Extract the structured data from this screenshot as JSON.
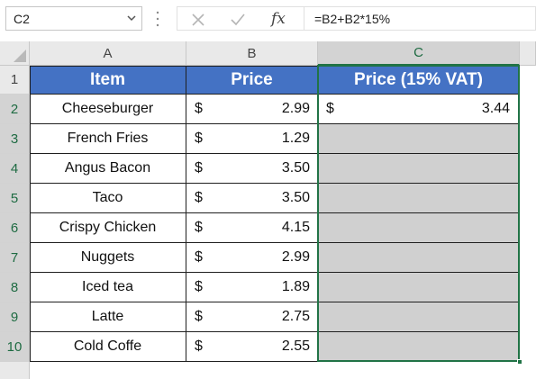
{
  "formula_bar": {
    "name_box": "C2",
    "formula": "=B2+B2*15%",
    "fx_label": "fx"
  },
  "columns": [
    "A",
    "B",
    "C"
  ],
  "rows": [
    "1",
    "2",
    "3",
    "4",
    "5",
    "6",
    "7",
    "8",
    "9",
    "10"
  ],
  "table": {
    "headers": {
      "item": "Item",
      "price": "Price",
      "vat": "Price (15% VAT)"
    },
    "currency": "$",
    "items": [
      {
        "item": "Cheeseburger",
        "price": "2.99",
        "vat": "3.44"
      },
      {
        "item": "French Fries",
        "price": "1.29",
        "vat": ""
      },
      {
        "item": "Angus Bacon",
        "price": "3.50",
        "vat": ""
      },
      {
        "item": "Taco",
        "price": "3.50",
        "vat": ""
      },
      {
        "item": "Crispy Chicken",
        "price": "4.15",
        "vat": ""
      },
      {
        "item": "Nuggets",
        "price": "2.99",
        "vat": ""
      },
      {
        "item": "Iced tea",
        "price": "1.89",
        "vat": ""
      },
      {
        "item": "Latte",
        "price": "2.75",
        "vat": ""
      },
      {
        "item": "Cold Coffe",
        "price": "2.55",
        "vat": ""
      }
    ]
  },
  "colors": {
    "header_fill": "#4472c4",
    "selection": "#217346",
    "empty_fill": "#d0d0d0"
  }
}
